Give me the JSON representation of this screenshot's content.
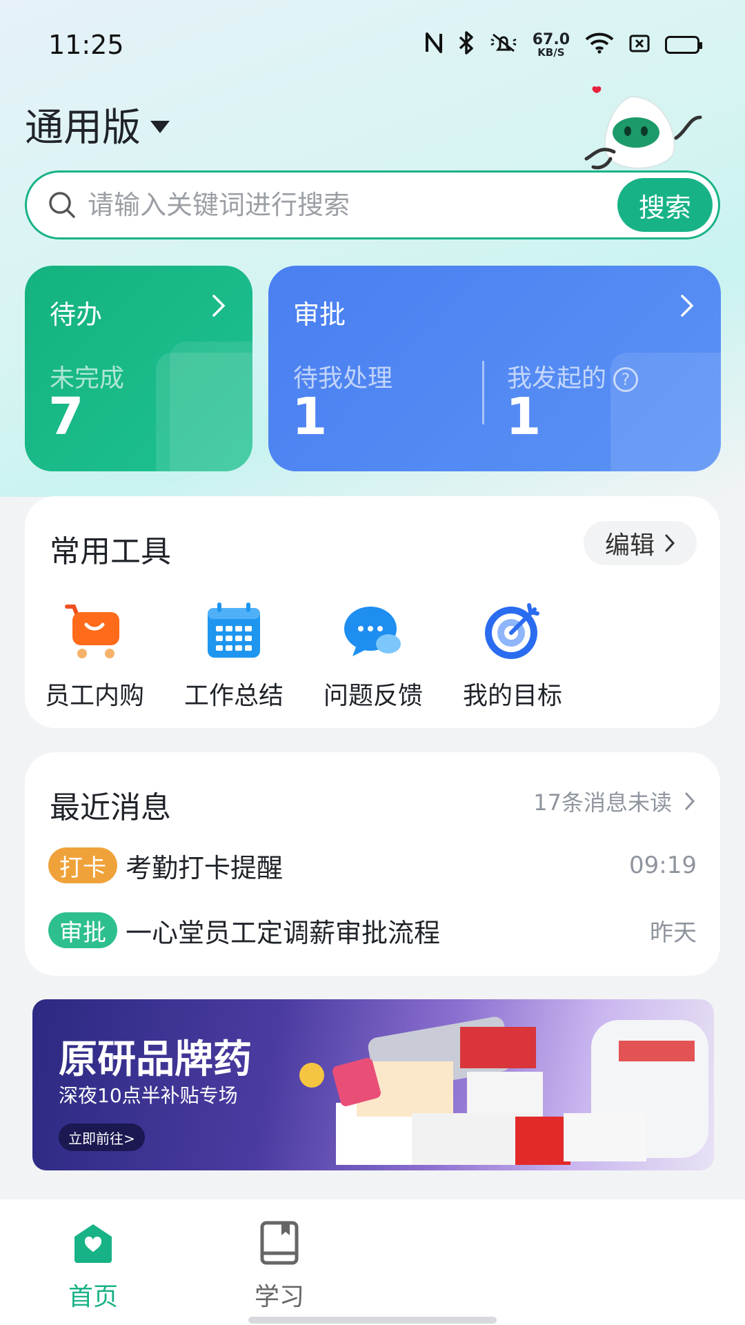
{
  "status_bar": {
    "time": "11:25",
    "net_speed": "67.0",
    "net_unit": "KB/S",
    "icons": [
      "nfc-icon",
      "bluetooth-icon",
      "mute-icon",
      "wifi-icon",
      "sim-icon",
      "battery-icon"
    ]
  },
  "header": {
    "title": "通用版"
  },
  "search": {
    "placeholder": "请输入关键词进行搜索",
    "button_label": "搜索"
  },
  "todo_card": {
    "title": "待办",
    "sub_label": "未完成",
    "count": "7"
  },
  "approve_card": {
    "title": "审批",
    "pending_label": "待我处理",
    "pending_count": "1",
    "initiated_label": "我发起的",
    "initiated_count": "1",
    "help_glyph": "?"
  },
  "tools": {
    "title": "常用工具",
    "edit_label": "编辑",
    "items": [
      {
        "label": "员工内购",
        "icon": "shopping-cart-icon"
      },
      {
        "label": "工作总结",
        "icon": "calendar-icon"
      },
      {
        "label": "问题反馈",
        "icon": "chat-bubble-icon"
      },
      {
        "label": "我的目标",
        "icon": "target-icon"
      }
    ]
  },
  "messages": {
    "title": "最近消息",
    "unread": "17条消息未读",
    "items": [
      {
        "badge": "打卡",
        "badge_color": "#f0a23a",
        "text": "考勤打卡提醒",
        "time": "09:19"
      },
      {
        "badge": "审批",
        "badge_color": "#2ebf8f",
        "text": "一心堂员工定调薪审批流程",
        "time": "昨天"
      }
    ]
  },
  "banner": {
    "title": "原研品牌药",
    "subtitle": "深夜10点半补贴专场",
    "button": "立即前往>"
  },
  "bottom_nav": {
    "items": [
      {
        "label": "首页",
        "active": true,
        "icon": "home-icon"
      },
      {
        "label": "学习",
        "active": false,
        "icon": "book-icon"
      }
    ],
    "active_color": "#18b287",
    "inactive_color": "#666666"
  }
}
